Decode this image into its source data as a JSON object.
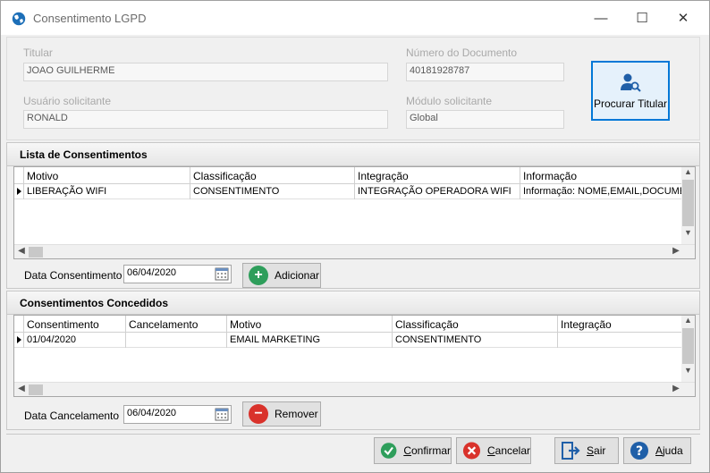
{
  "window": {
    "title": "Consentimento LGPD",
    "minimize": "—",
    "maximize": "☐",
    "close": "✕"
  },
  "titular": {
    "titular_label": "Titular",
    "titular_value": "JOAO GUILHERME",
    "documento_label": "Número do Documento",
    "documento_value": "40181928787",
    "usuario_label": "Usuário solicitante",
    "usuario_value": "RONALD",
    "modulo_label": "Módulo solicitante",
    "modulo_value": "Global",
    "search_button": "Procurar Titular"
  },
  "lista": {
    "header": "Lista de Consentimentos",
    "columns": [
      "Motivo",
      "Classificação",
      "Integração",
      "Informação"
    ],
    "rows": [
      [
        "LIBERAÇÃO WIFI",
        "CONSENTIMENTO",
        "INTEGRAÇÃO OPERADORA WIFI",
        "Informação: NOME,EMAIL,DOCUMENTO"
      ]
    ],
    "date_label": "Data Consentimento",
    "date_value": "06/04/2020",
    "add_button": "Adicionar"
  },
  "concedidos": {
    "header": "Consentimentos Concedidos",
    "columns": [
      "Consentimento",
      "Cancelamento",
      "Motivo",
      "Classificação",
      "Integração"
    ],
    "rows": [
      [
        "01/04/2020",
        "",
        "EMAIL MARKETING",
        "CONSENTIMENTO",
        ""
      ]
    ],
    "date_label": "Data Cancelamento",
    "date_value": "06/04/2020",
    "remove_button": "Remover"
  },
  "footer": {
    "confirm_first": "C",
    "confirm_rest": "onfirmar",
    "cancel_first": "C",
    "cancel_rest": "ancelar",
    "exit_first": "S",
    "exit_rest": "air",
    "help_first": "A",
    "help_rest": "juda"
  },
  "colors": {
    "accent": "#0078d7",
    "add": "#2e9e5b",
    "remove": "#d9322b"
  }
}
